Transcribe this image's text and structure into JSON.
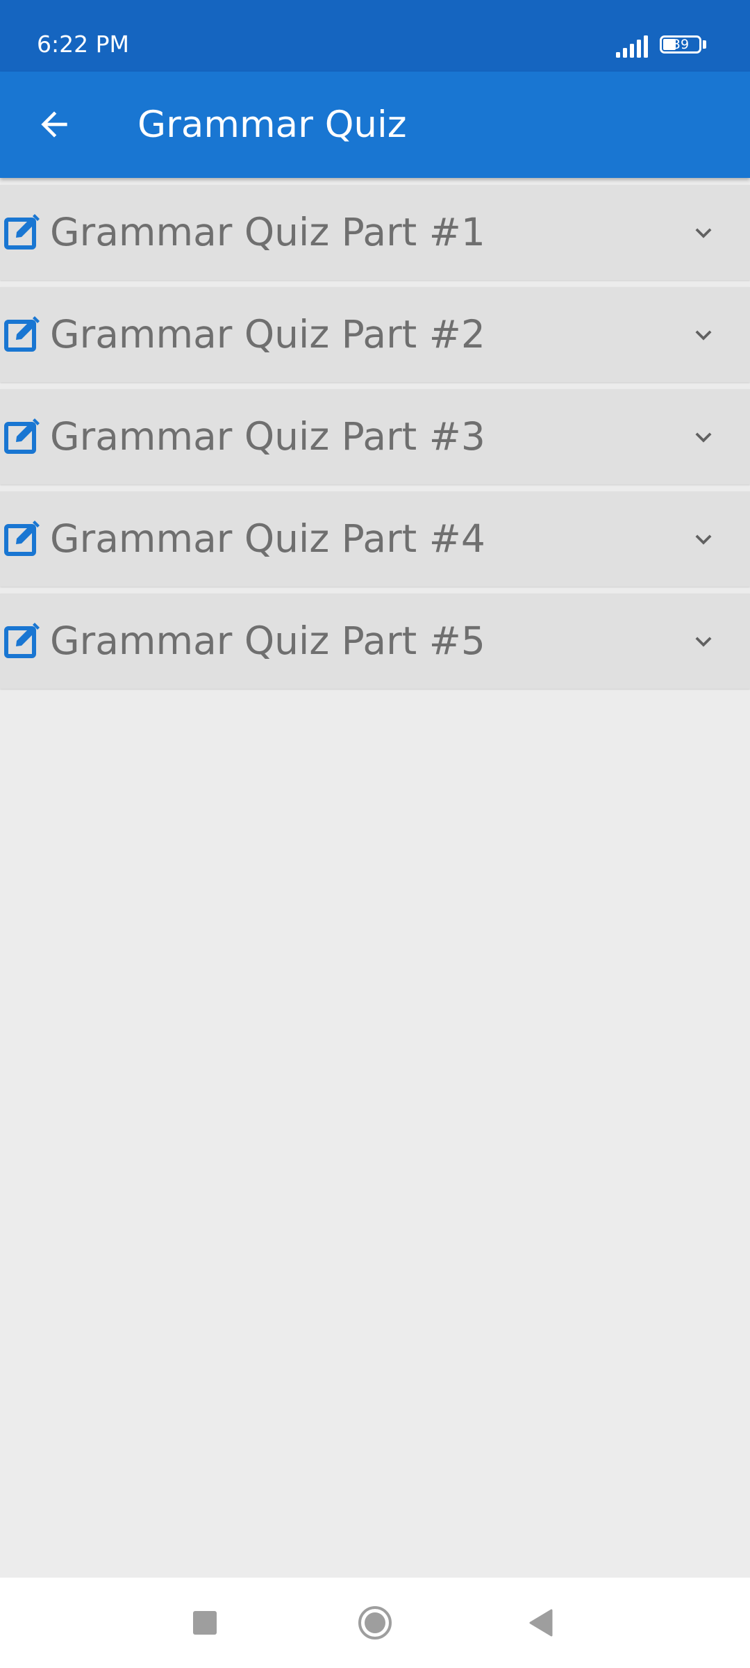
{
  "status_bar": {
    "time": "6:22 PM",
    "battery_level": "39",
    "signal_icon": "signal-icon",
    "battery_icon": "battery-icon"
  },
  "app_bar": {
    "title": "Grammar Quiz",
    "back_icon": "arrow-back-icon",
    "background_color": "#1976d2",
    "status_color": "#1565c0"
  },
  "quiz_list": {
    "items": [
      {
        "label": "Grammar Quiz Part #1",
        "icon": "edit-icon",
        "expand_icon": "chevron-down-icon"
      },
      {
        "label": "Grammar Quiz Part #2",
        "icon": "edit-icon",
        "expand_icon": "chevron-down-icon"
      },
      {
        "label": "Grammar Quiz Part #3",
        "icon": "edit-icon",
        "expand_icon": "chevron-down-icon"
      },
      {
        "label": "Grammar Quiz Part #4",
        "icon": "edit-icon",
        "expand_icon": "chevron-down-icon"
      },
      {
        "label": "Grammar Quiz Part #5",
        "icon": "edit-icon",
        "expand_icon": "chevron-down-icon"
      }
    ],
    "accent_color": "#1976d2"
  },
  "nav_bar": {
    "buttons": [
      "recents-icon",
      "home-icon",
      "back-triangle-icon"
    ]
  }
}
